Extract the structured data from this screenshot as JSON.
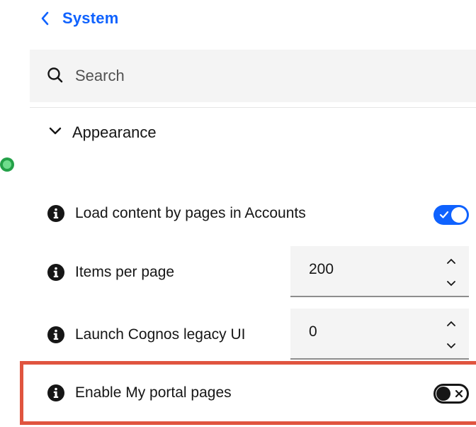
{
  "header": {
    "title": "System"
  },
  "search": {
    "placeholder": "Search"
  },
  "section": {
    "label": "Appearance"
  },
  "settings": [
    {
      "label": "Load content by pages in Accounts",
      "type": "toggle",
      "on": true
    },
    {
      "label": "Items per page",
      "type": "number",
      "value": "200"
    },
    {
      "label": "Launch Cognos legacy UI",
      "type": "number",
      "value": "0"
    },
    {
      "label": "Enable My portal pages",
      "type": "toggle",
      "on": false
    }
  ],
  "colors": {
    "accent": "#0f62fe",
    "highlight_border": "#e0543f",
    "field_background": "#f4f4f4"
  }
}
